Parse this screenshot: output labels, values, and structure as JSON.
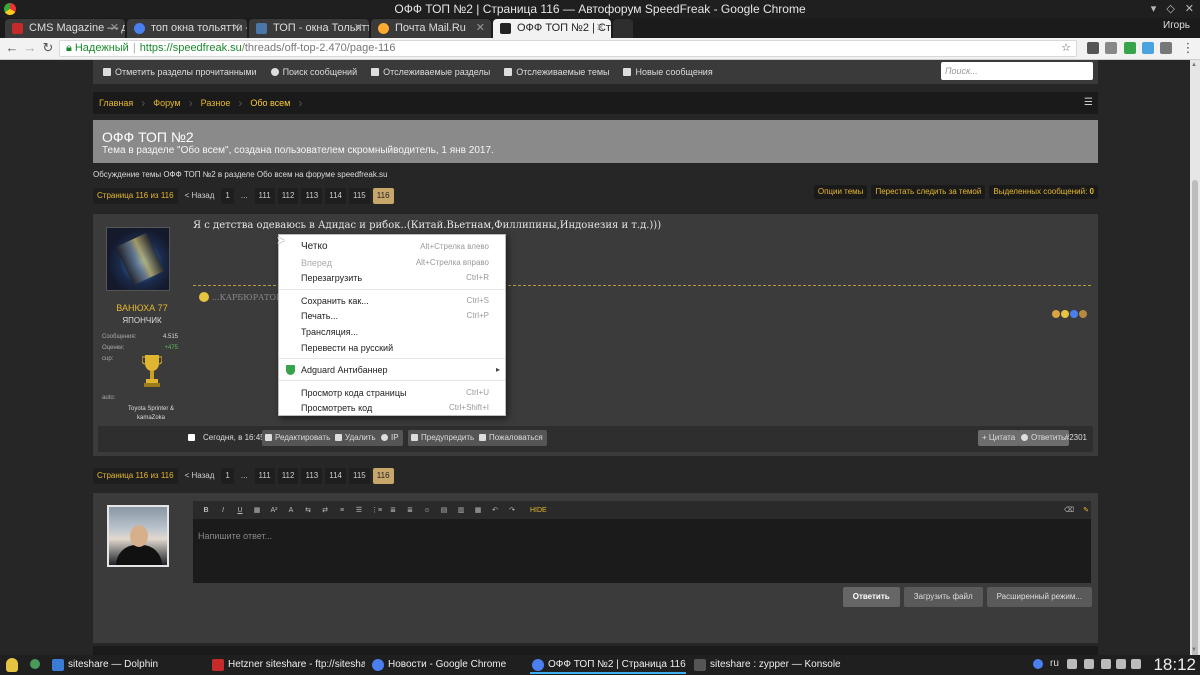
{
  "window": {
    "title": "ОФФ ТОП №2 | Страница 116 — Автофорум SpeedFreak - Google Chrome",
    "user": "Игорь"
  },
  "tabs": [
    {
      "label": "CMS Magazine — для",
      "icon_color": "#c62b2b"
    },
    {
      "label": "топ окна тольятти - ",
      "icon_color": "#4a7ff0"
    },
    {
      "label": "ТОП - окна Тольятти",
      "icon_color": "#4a76a8"
    },
    {
      "label": "Почта Mail.Ru",
      "icon_color": "#ffa930"
    },
    {
      "label": "ОФФ ТОП №2 | Стра",
      "icon_color": "#222222"
    }
  ],
  "address": {
    "secure_label": "Надежный",
    "host": "https://speedfreak.su",
    "path": "/threads/off-top-2.470/page-116"
  },
  "forum_nav": {
    "items": [
      "Отметить разделы прочитанными",
      "Поиск сообщений",
      "Отслеживаемые разделы",
      "Отслеживаемые темы",
      "Новые сообщения"
    ],
    "search_placeholder": "Поиск..."
  },
  "breadcrumbs": [
    "Главная",
    "Форум",
    "Разное",
    "Обо всем"
  ],
  "thread": {
    "title": "ОФФ ТОП №2",
    "subtitle": "Тема в разделе \"Обо всем\", создана пользователем скромныйводитель, 1 янв 2017.",
    "description": "Обсуждение темы ОФФ ТОП №2 в разделе Обо всем на форуме speedfreak.su"
  },
  "pager": {
    "label": "Страница 116 из 116",
    "prev": "< Назад",
    "pages": [
      "1",
      "...",
      "111",
      "112",
      "113",
      "114",
      "115",
      "116"
    ],
    "current": "116"
  },
  "thread_tools": {
    "options": "Опции темы",
    "unwatch": "Перестать следить за темой",
    "selected_label": "Выделенных сообщений:",
    "selected_count": "0"
  },
  "post": {
    "author": "ВАНЮХА 77",
    "rank": "ЯПОНЧИК",
    "messages_label": "Сообщения:",
    "messages": "4.515",
    "rating_label": "Оценки:",
    "rating": "+475",
    "cup_label": "cup:",
    "auto_label": "auto:",
    "auto_value": "Toyota Sprinter & kamaZoka",
    "text": "Я с детства одеваюсь в Адидас и рибок..(Китай.Вьетнам,Филлипины,Индонезия и т.д.)))",
    "signature": "...КАРБЮРАТОР Н",
    "date": "Сегодня, в 16:45",
    "buttons": [
      "Редактировать",
      "Удалить",
      "IP",
      "Предупредить",
      "Пожаловаться"
    ],
    "quote": "+ Цитата",
    "reply": "Ответить",
    "number": "#2301"
  },
  "editor": {
    "placeholder": "Напишите ответ...",
    "tools": [
      "B",
      "I",
      "U",
      "▦",
      "A²",
      "A",
      "⇆",
      "⇄",
      "≡",
      "☰",
      "⋮≡",
      "≣",
      "≣",
      "☺",
      "▤",
      "▥",
      "▦",
      "↶",
      "↷"
    ],
    "hide": "HIDE",
    "submit": "Ответить",
    "upload": "Загрузить файл",
    "advanced": "Расширенный режим..."
  },
  "context_menu": {
    "items": [
      {
        "label": "Четко",
        "shortcut": "Alt+Стрелка влево"
      },
      {
        "label": "Вперед",
        "shortcut": "Alt+Стрелка вправо",
        "disabled": true
      },
      {
        "label": "Перезагрузить",
        "shortcut": "Ctrl+R"
      },
      {
        "label": "Сохранить как...",
        "shortcut": "Ctrl+S"
      },
      {
        "label": "Печать...",
        "shortcut": "Ctrl+P"
      },
      {
        "label": "Трансляция...",
        "shortcut": ""
      },
      {
        "label": "Перевести на русский",
        "shortcut": ""
      },
      {
        "label": "Adguard Антибаннер",
        "shortcut": ""
      },
      {
        "label": "Просмотр кода страницы",
        "shortcut": "Ctrl+U"
      },
      {
        "label": "Просмотреть код",
        "shortcut": "Ctrl+Shift+I"
      }
    ]
  },
  "taskbar": {
    "items": [
      {
        "label": "siteshare — Dolphin",
        "icon_color": "#3a7bd5"
      },
      {
        "label": "Hetzner siteshare - ftp://siteshare...",
        "icon_color": "#c62b2b"
      },
      {
        "label": "Новости - Google Chrome",
        "icon_color": "#4a7ff0"
      },
      {
        "label": "ОФФ ТОП №2 | Страница 116 —",
        "icon_color": "#4a7ff0"
      },
      {
        "label": "siteshare : zypper — Konsole",
        "icon_color": "#555555"
      }
    ],
    "lang": "ru",
    "clock": "18:12"
  }
}
